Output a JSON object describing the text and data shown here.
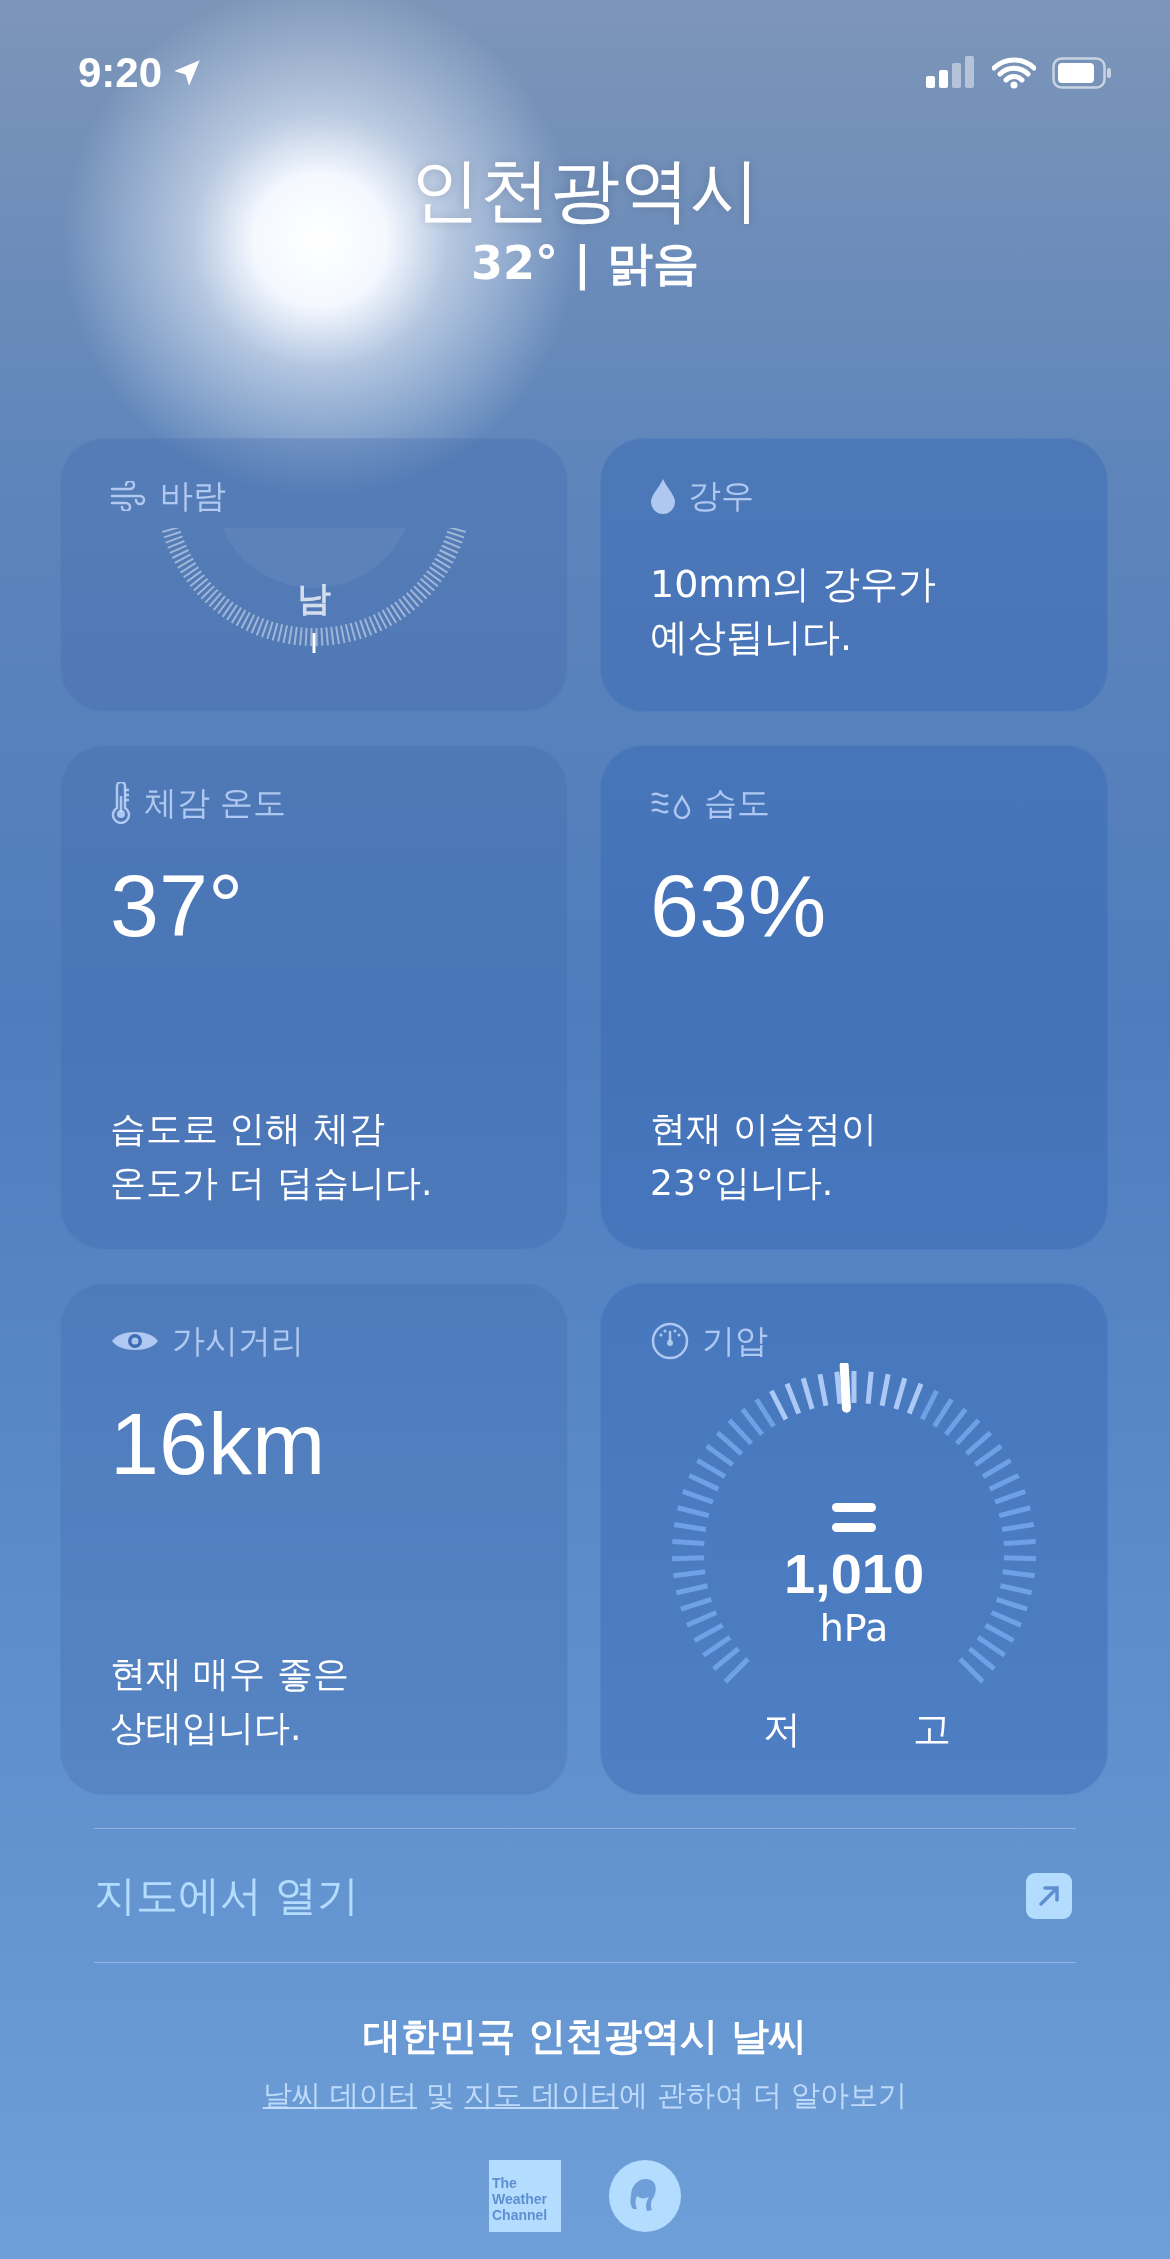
{
  "status_bar": {
    "time": "9:20"
  },
  "location": {
    "city": "인천광역시",
    "summary": "32° | 맑음"
  },
  "cards": [
    {
      "kind": "wind",
      "title": "바람",
      "direction": "남"
    },
    {
      "kind": "rain",
      "title": "강우",
      "text": "10mm의 강우가\n예상됩니다."
    },
    {
      "kind": "feels_like",
      "title": "체감 온도",
      "value": "37°",
      "text": "습도로 인해 체감\n온도가 더 덥습니다."
    },
    {
      "kind": "humidity",
      "title": "습도",
      "value": "63%",
      "text": "현재 이슬점이\n23°입니다."
    },
    {
      "kind": "visibility",
      "title": "가시거리",
      "value": "16km",
      "text": "현재 매우 좋은\n상태입니다."
    },
    {
      "kind": "pressure",
      "title": "기압",
      "value": "1,010",
      "unit": "hPa",
      "low": "저",
      "high": "고"
    }
  ],
  "map_link": {
    "label": "지도에서 열기"
  },
  "footer": {
    "title": "대한민국 인천광역시 날씨",
    "attribution": [
      {
        "text": "날씨 데이터",
        "link": true
      },
      {
        "text": " 및 ",
        "link": false
      },
      {
        "text": "지도 데이터",
        "link": true
      },
      {
        "text": "에 관하여 더 알아보기",
        "link": false
      }
    ],
    "logo_text": [
      "The",
      "Weather",
      "Channel"
    ]
  }
}
